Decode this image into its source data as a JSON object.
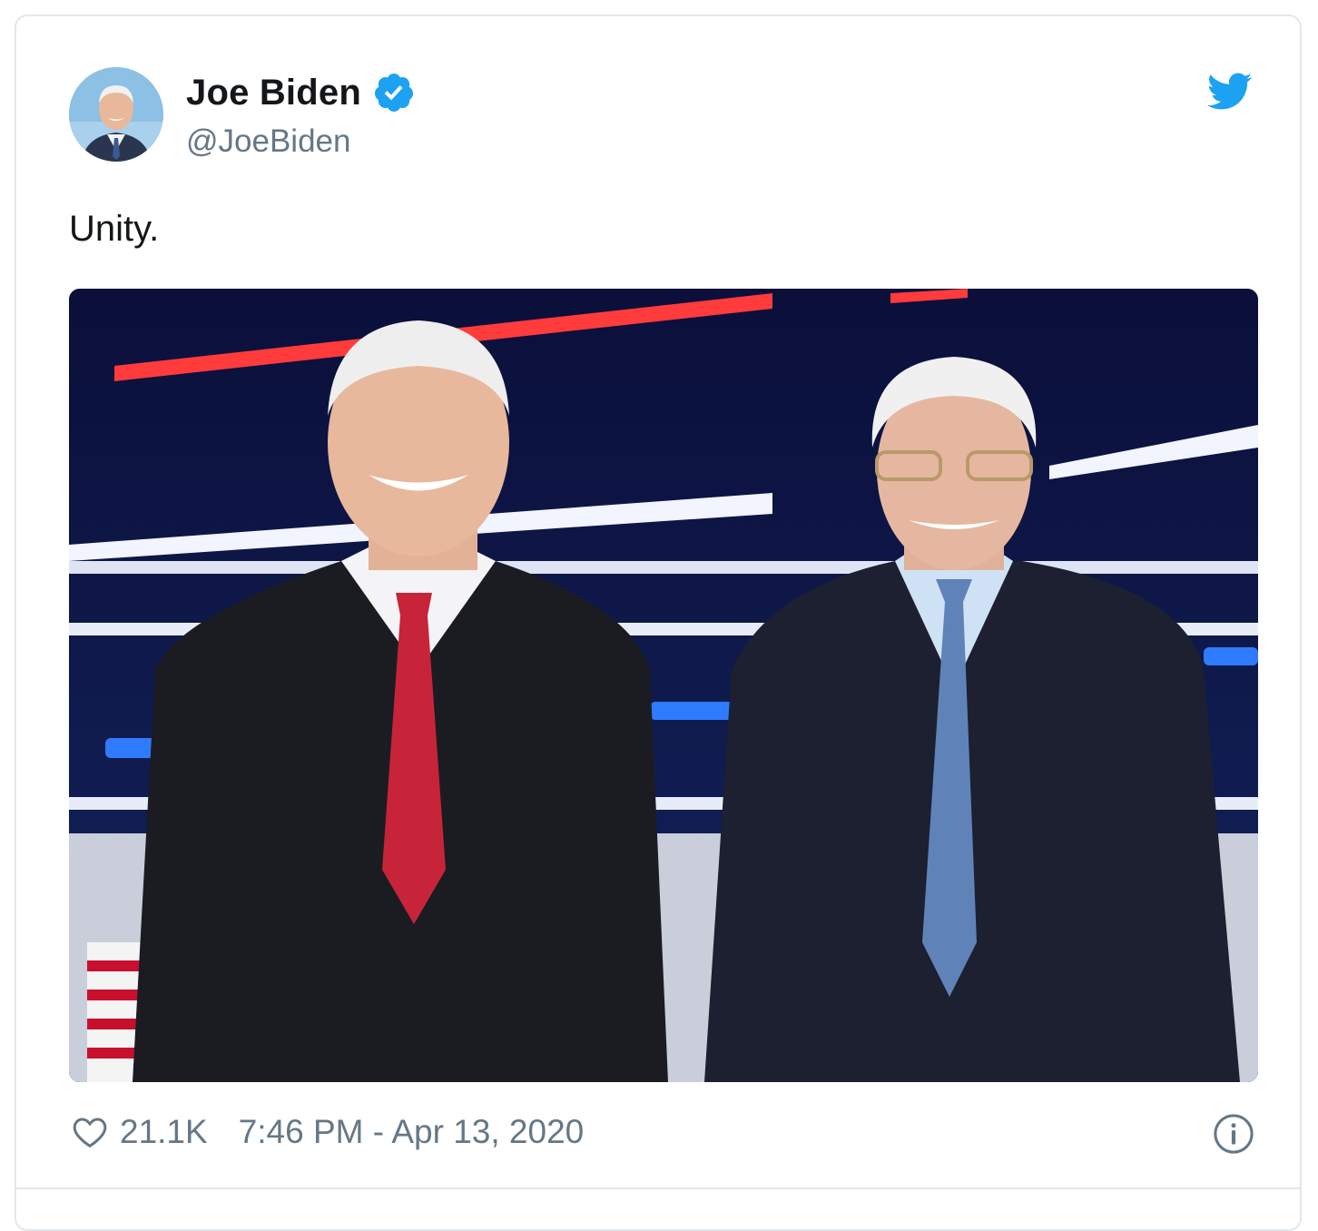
{
  "tweet": {
    "author_name": "Joe Biden",
    "author_handle": "@JoeBiden",
    "text": "Unity.",
    "likes": "21.1K",
    "timestamp": "7:46 PM - Apr 13, 2020",
    "icons": {
      "verified": "verified-badge-icon",
      "brand": "twitter-bird-icon",
      "like": "heart-icon",
      "info": "info-icon"
    }
  },
  "colors": {
    "twitter_blue": "#1da1f2",
    "text_primary": "#14171a",
    "text_secondary": "#657786",
    "border": "#e1e8ed"
  }
}
